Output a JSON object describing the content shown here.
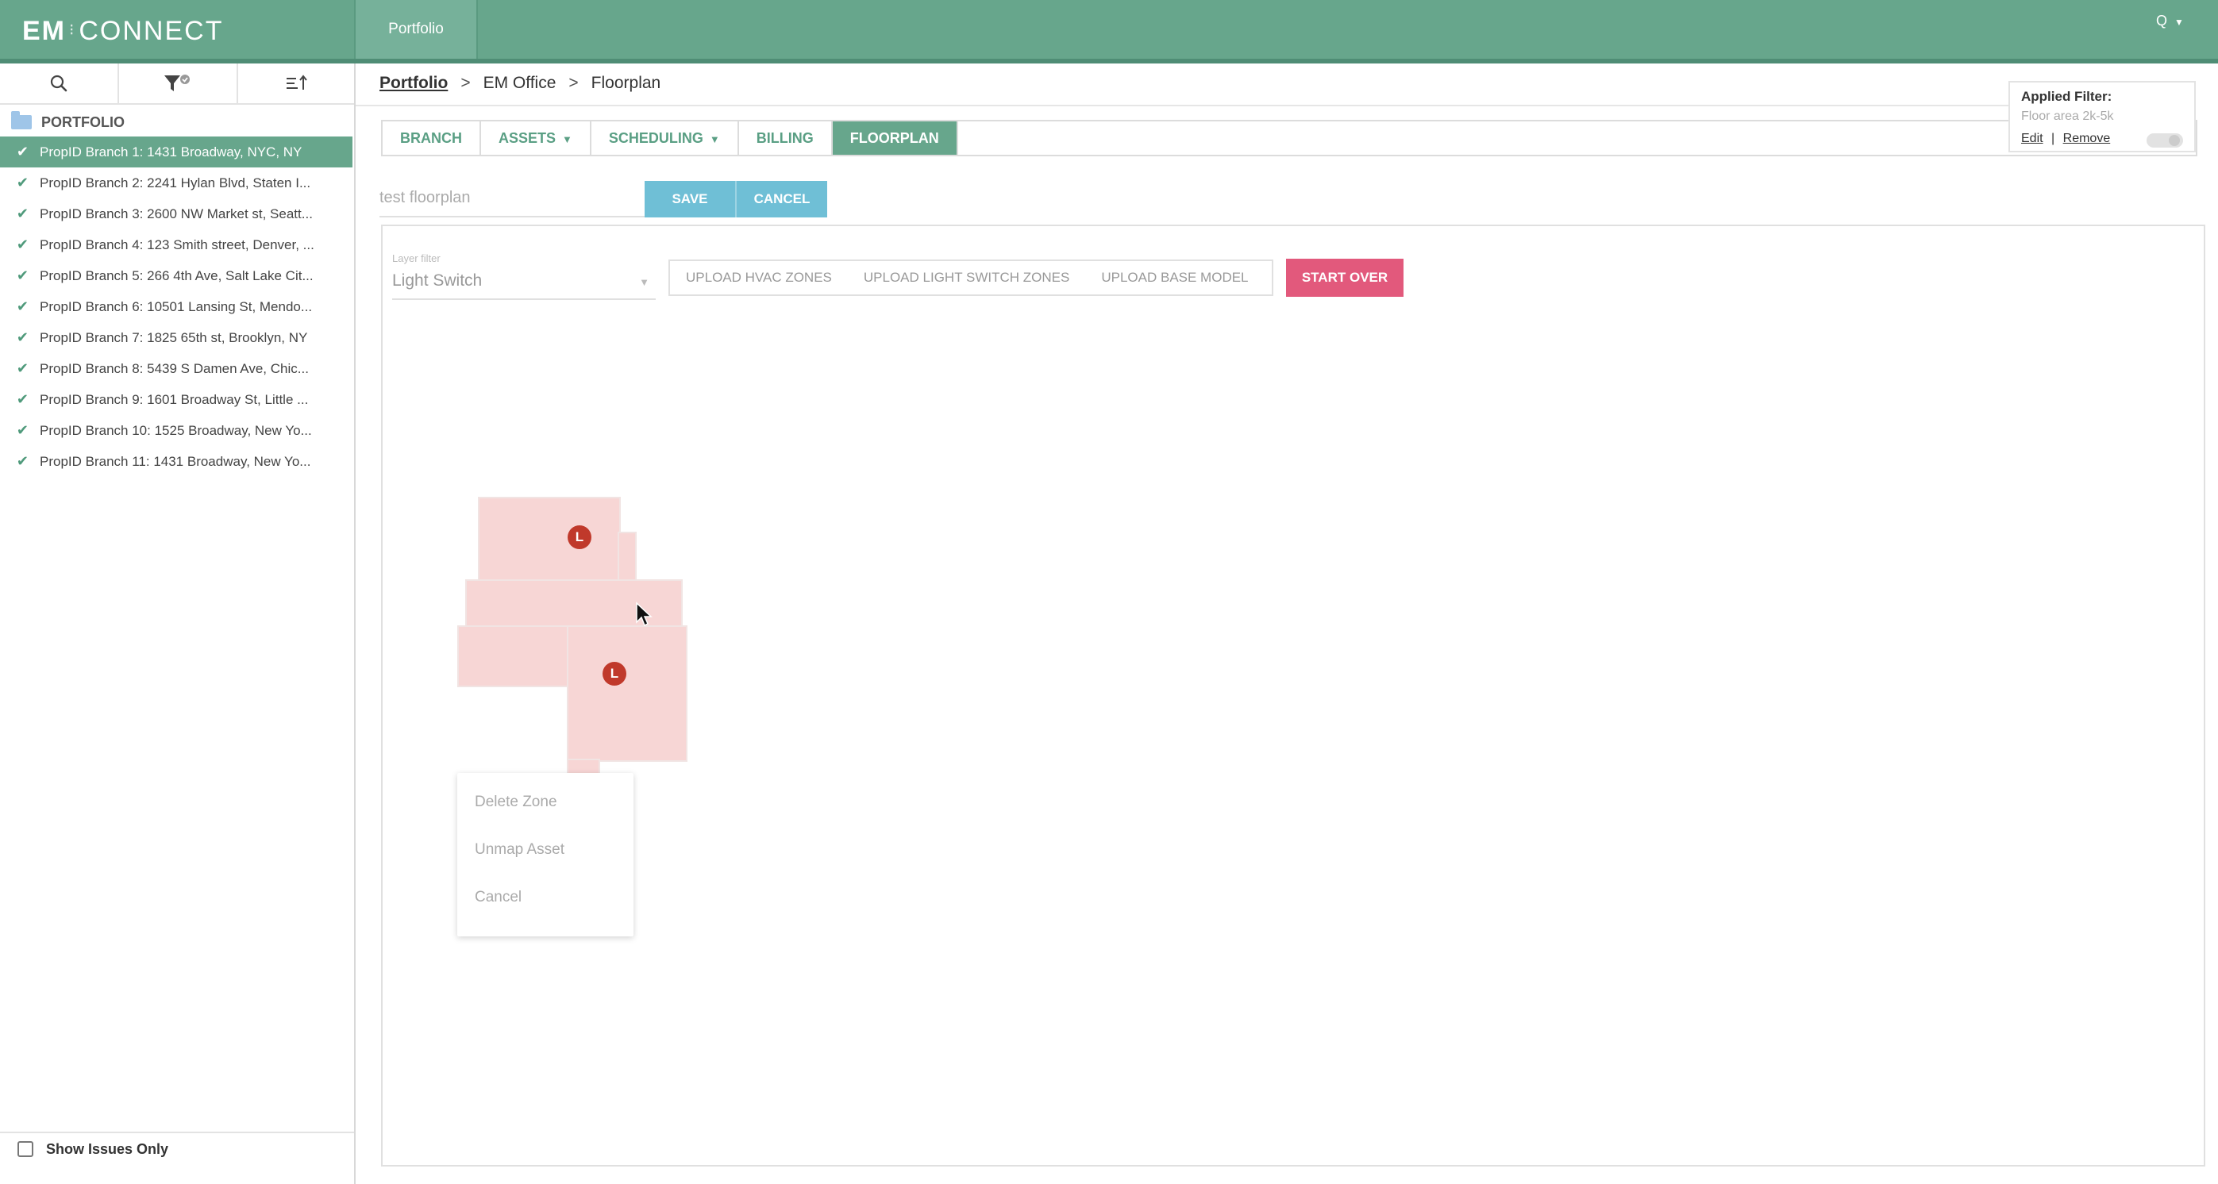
{
  "app": {
    "logo_em": "EM",
    "logo_rest": "CONNECT",
    "top_tab": "Portfolio",
    "user_menu": "Q"
  },
  "sidebar": {
    "portfolio_label": "PORTFOLIO",
    "branches": [
      {
        "label": "PropID Branch 1: 1431 Broadway, NYC, NY",
        "active": true
      },
      {
        "label": "PropID Branch 2: 2241 Hylan Blvd, Staten I..."
      },
      {
        "label": "PropID Branch 3: 2600 NW Market st, Seatt..."
      },
      {
        "label": "PropID Branch 4: 123 Smith street, Denver, ..."
      },
      {
        "label": "PropID Branch 5: 266 4th Ave, Salt Lake Cit..."
      },
      {
        "label": "PropID Branch 6: 10501 Lansing St, Mendo..."
      },
      {
        "label": "PropID Branch 7: 1825 65th st, Brooklyn, NY"
      },
      {
        "label": "PropID Branch 8: 5439 S Damen Ave, Chic..."
      },
      {
        "label": "PropID Branch 9: 1601 Broadway St, Little ..."
      },
      {
        "label": "PropID Branch 10: 1525 Broadway, New Yo..."
      },
      {
        "label": "PropID Branch 11: 1431 Broadway, New Yo..."
      }
    ],
    "show_issues_label": "Show Issues Only",
    "show_issues_checked": false
  },
  "breadcrumb": {
    "root": "Portfolio",
    "sep": ">",
    "level2": "EM Office",
    "level3": "Floorplan"
  },
  "tabs": [
    {
      "label": "BRANCH",
      "dropdown": false,
      "active": false
    },
    {
      "label": "ASSETS",
      "dropdown": true,
      "active": false
    },
    {
      "label": "SCHEDULING",
      "dropdown": true,
      "active": false
    },
    {
      "label": "BILLING",
      "dropdown": false,
      "active": false
    },
    {
      "label": "FLOORPLAN",
      "dropdown": false,
      "active": true
    }
  ],
  "filter": {
    "title": "Applied Filter:",
    "value": "Floor area 2k-5k",
    "edit": "Edit",
    "divider": "|",
    "remove": "Remove"
  },
  "floorplan": {
    "name_value": "test floorplan",
    "save": "SAVE",
    "cancel": "CANCEL",
    "layer_label": "Layer filter",
    "layer_value": "Light Switch",
    "upload_hvac": "UPLOAD HVAC ZONES",
    "upload_light": "UPLOAD LIGHT SWITCH ZONES",
    "upload_base": "UPLOAD BASE MODEL",
    "start_over": "START OVER",
    "marker_letter": "L"
  },
  "context_menu": {
    "delete_zone": "Delete Zone",
    "unmap_asset": "Unmap Asset",
    "cancel": "Cancel"
  },
  "colors": {
    "brand_green": "#67a68c",
    "save_blue": "#6fbfd6",
    "start_over_pink": "#e2597c",
    "zone_fill": "#f7d6d5",
    "marker_red": "#c0392b"
  },
  "icons": [
    "search-icon",
    "filter-icon",
    "sort-icon",
    "folder-icon",
    "check-icon",
    "chevron-down-icon",
    "cursor-icon"
  ]
}
